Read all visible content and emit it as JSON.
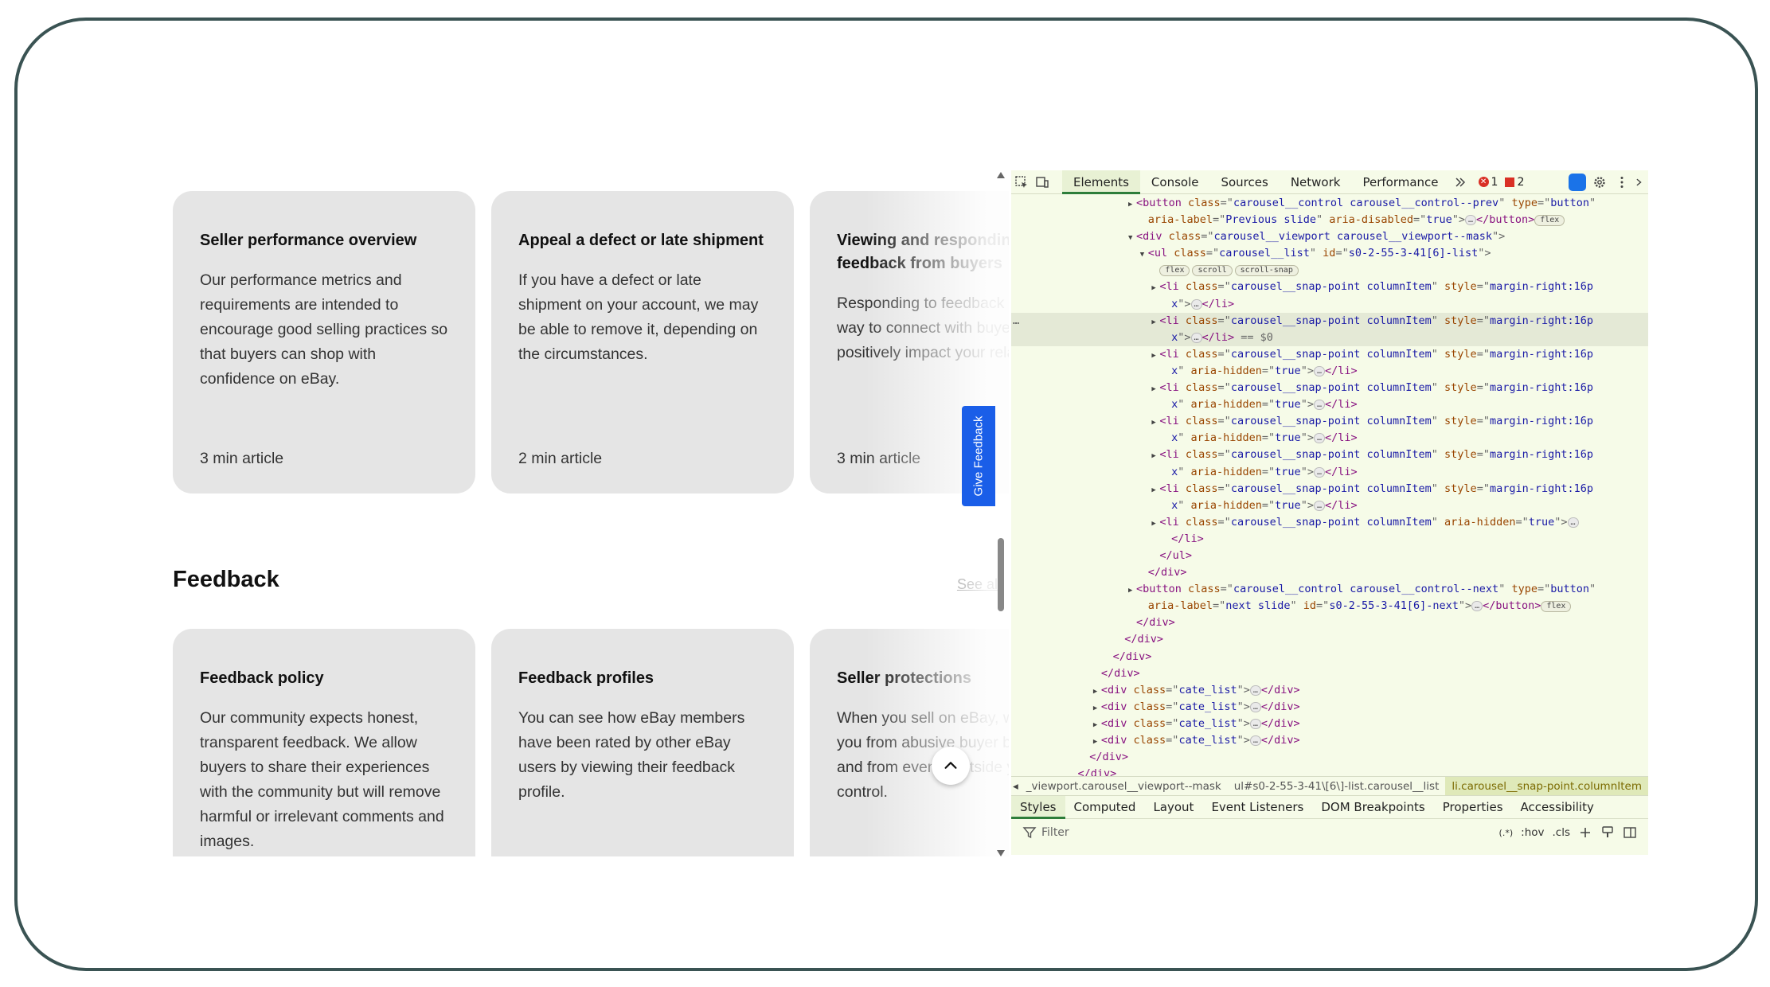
{
  "ebay": {
    "row1": [
      {
        "title": "Seller performance overview",
        "body": "Our performance metrics and requirements are intended to encourage good selling practices so that buyers can shop with confidence on eBay.",
        "meta": "3 min article"
      },
      {
        "title": "Appeal a defect or late shipment",
        "body": "If you have a defect or late shipment on your account, we may be able to remove it, depending on the circumstances.",
        "meta": "2 min article"
      },
      {
        "title": "Viewing and responding to feedback from buyers",
        "body": "Responding to feedback is a great way to connect with buyers and can positively impact your relationships.",
        "meta": "3 min article"
      }
    ],
    "section_title": "Feedback",
    "see_all": "See all",
    "row2": [
      {
        "title": "Feedback policy",
        "body": "Our community expects honest, transparent feedback. We allow buyers to share their experiences with the community but will remove harmful or irrelevant comments and images.",
        "meta": ""
      },
      {
        "title": "Feedback profiles",
        "body": "You can see how eBay members have been rated by other eBay users by viewing their feedback profile.",
        "meta": ""
      },
      {
        "title": "Seller protections",
        "body": "When you sell on eBay, we protect you from abusive buyer behavior and from events outside your control.",
        "meta": ""
      }
    ],
    "give_feedback": "Give Feedback"
  },
  "devtools": {
    "tabs": [
      "Elements",
      "Console",
      "Sources",
      "Network",
      "Performance"
    ],
    "error_count": "1",
    "warning_count": "2",
    "dom_lines": [
      {
        "indent": 10,
        "arrow": "▶",
        "parts": [
          [
            "t",
            "<button "
          ],
          [
            "a",
            "class"
          ],
          [
            "e",
            "=\""
          ],
          [
            "v",
            "carousel__control carousel__control--prev"
          ],
          [
            "e",
            "\" "
          ],
          [
            "a",
            "type"
          ],
          [
            "e",
            "=\""
          ],
          [
            "v",
            "button"
          ],
          [
            "e",
            "\""
          ]
        ]
      },
      {
        "indent": 11,
        "parts": [
          [
            "a",
            "aria-label"
          ],
          [
            "e",
            "=\""
          ],
          [
            "v",
            "Previous slide"
          ],
          [
            "e",
            "\" "
          ],
          [
            "a",
            "aria-disabled"
          ],
          [
            "e",
            "=\""
          ],
          [
            "v",
            "true"
          ],
          [
            "e",
            "\">"
          ],
          [
            "x",
            "…"
          ],
          [
            "t",
            "</button>"
          ],
          [
            "b",
            "flex"
          ]
        ]
      },
      {
        "indent": 10,
        "arrow": "▼",
        "parts": [
          [
            "t",
            "<div "
          ],
          [
            "a",
            "class"
          ],
          [
            "e",
            "=\""
          ],
          [
            "v",
            "carousel__viewport carousel__viewport--mask"
          ],
          [
            "e",
            "\">"
          ]
        ]
      },
      {
        "indent": 11,
        "arrow": "▼",
        "parts": [
          [
            "t",
            "<ul "
          ],
          [
            "a",
            "class"
          ],
          [
            "e",
            "=\""
          ],
          [
            "v",
            "carousel__list"
          ],
          [
            "e",
            "\" "
          ],
          [
            "a",
            "id"
          ],
          [
            "e",
            "=\""
          ],
          [
            "v",
            "s0-2-55-3-41[6]-list"
          ],
          [
            "e",
            "\">"
          ]
        ]
      },
      {
        "indent": 12,
        "parts": [
          [
            "b",
            "flex"
          ],
          [
            "b",
            "scroll"
          ],
          [
            "b",
            "scroll-snap"
          ]
        ]
      },
      {
        "indent": 12,
        "arrow": "▶",
        "parts": [
          [
            "t",
            "<li "
          ],
          [
            "a",
            "class"
          ],
          [
            "e",
            "=\""
          ],
          [
            "v",
            "carousel__snap-point columnItem"
          ],
          [
            "e",
            "\" "
          ],
          [
            "a",
            "style"
          ],
          [
            "e",
            "=\""
          ],
          [
            "v",
            "margin-right:16p"
          ]
        ]
      },
      {
        "indent": 13,
        "parts": [
          [
            "v",
            "x"
          ],
          [
            "e",
            "\">"
          ],
          [
            "x",
            "…"
          ],
          [
            "t",
            "</li>"
          ]
        ]
      },
      {
        "indent": 12,
        "arrow": "▶",
        "selected": true,
        "parts": [
          [
            "t",
            "<li "
          ],
          [
            "a",
            "class"
          ],
          [
            "e",
            "=\""
          ],
          [
            "v",
            "carousel__snap-point columnItem"
          ],
          [
            "e",
            "\" "
          ],
          [
            "a",
            "style"
          ],
          [
            "e",
            "=\""
          ],
          [
            "v",
            "margin-right:16p"
          ]
        ]
      },
      {
        "indent": 13,
        "selected": true,
        "parts": [
          [
            "v",
            "x"
          ],
          [
            "e",
            "\">"
          ],
          [
            "x",
            "…"
          ],
          [
            "t",
            "</li>"
          ],
          [
            "e",
            " == $0"
          ]
        ]
      },
      {
        "indent": 12,
        "arrow": "▶",
        "parts": [
          [
            "t",
            "<li "
          ],
          [
            "a",
            "class"
          ],
          [
            "e",
            "=\""
          ],
          [
            "v",
            "carousel__snap-point columnItem"
          ],
          [
            "e",
            "\" "
          ],
          [
            "a",
            "style"
          ],
          [
            "e",
            "=\""
          ],
          [
            "v",
            "margin-right:16p"
          ]
        ]
      },
      {
        "indent": 13,
        "parts": [
          [
            "v",
            "x"
          ],
          [
            "e",
            "\" "
          ],
          [
            "a",
            "aria-hidden"
          ],
          [
            "e",
            "=\""
          ],
          [
            "v",
            "true"
          ],
          [
            "e",
            "\">"
          ],
          [
            "x",
            "…"
          ],
          [
            "t",
            "</li>"
          ]
        ]
      },
      {
        "indent": 12,
        "arrow": "▶",
        "parts": [
          [
            "t",
            "<li "
          ],
          [
            "a",
            "class"
          ],
          [
            "e",
            "=\""
          ],
          [
            "v",
            "carousel__snap-point columnItem"
          ],
          [
            "e",
            "\" "
          ],
          [
            "a",
            "style"
          ],
          [
            "e",
            "=\""
          ],
          [
            "v",
            "margin-right:16p"
          ]
        ]
      },
      {
        "indent": 13,
        "parts": [
          [
            "v",
            "x"
          ],
          [
            "e",
            "\" "
          ],
          [
            "a",
            "aria-hidden"
          ],
          [
            "e",
            "=\""
          ],
          [
            "v",
            "true"
          ],
          [
            "e",
            "\">"
          ],
          [
            "x",
            "…"
          ],
          [
            "t",
            "</li>"
          ]
        ]
      },
      {
        "indent": 12,
        "arrow": "▶",
        "parts": [
          [
            "t",
            "<li "
          ],
          [
            "a",
            "class"
          ],
          [
            "e",
            "=\""
          ],
          [
            "v",
            "carousel__snap-point columnItem"
          ],
          [
            "e",
            "\" "
          ],
          [
            "a",
            "style"
          ],
          [
            "e",
            "=\""
          ],
          [
            "v",
            "margin-right:16p"
          ]
        ]
      },
      {
        "indent": 13,
        "parts": [
          [
            "v",
            "x"
          ],
          [
            "e",
            "\" "
          ],
          [
            "a",
            "aria-hidden"
          ],
          [
            "e",
            "=\""
          ],
          [
            "v",
            "true"
          ],
          [
            "e",
            "\">"
          ],
          [
            "x",
            "…"
          ],
          [
            "t",
            "</li>"
          ]
        ]
      },
      {
        "indent": 12,
        "arrow": "▶",
        "parts": [
          [
            "t",
            "<li "
          ],
          [
            "a",
            "class"
          ],
          [
            "e",
            "=\""
          ],
          [
            "v",
            "carousel__snap-point columnItem"
          ],
          [
            "e",
            "\" "
          ],
          [
            "a",
            "style"
          ],
          [
            "e",
            "=\""
          ],
          [
            "v",
            "margin-right:16p"
          ]
        ]
      },
      {
        "indent": 13,
        "parts": [
          [
            "v",
            "x"
          ],
          [
            "e",
            "\" "
          ],
          [
            "a",
            "aria-hidden"
          ],
          [
            "e",
            "=\""
          ],
          [
            "v",
            "true"
          ],
          [
            "e",
            "\">"
          ],
          [
            "x",
            "…"
          ],
          [
            "t",
            "</li>"
          ]
        ]
      },
      {
        "indent": 12,
        "arrow": "▶",
        "parts": [
          [
            "t",
            "<li "
          ],
          [
            "a",
            "class"
          ],
          [
            "e",
            "=\""
          ],
          [
            "v",
            "carousel__snap-point columnItem"
          ],
          [
            "e",
            "\" "
          ],
          [
            "a",
            "style"
          ],
          [
            "e",
            "=\""
          ],
          [
            "v",
            "margin-right:16p"
          ]
        ]
      },
      {
        "indent": 13,
        "parts": [
          [
            "v",
            "x"
          ],
          [
            "e",
            "\" "
          ],
          [
            "a",
            "aria-hidden"
          ],
          [
            "e",
            "=\""
          ],
          [
            "v",
            "true"
          ],
          [
            "e",
            "\">"
          ],
          [
            "x",
            "…"
          ],
          [
            "t",
            "</li>"
          ]
        ]
      },
      {
        "indent": 12,
        "arrow": "▶",
        "parts": [
          [
            "t",
            "<li "
          ],
          [
            "a",
            "class"
          ],
          [
            "e",
            "=\""
          ],
          [
            "v",
            "carousel__snap-point columnItem"
          ],
          [
            "e",
            "\" "
          ],
          [
            "a",
            "aria-hidden"
          ],
          [
            "e",
            "=\""
          ],
          [
            "v",
            "true"
          ],
          [
            "e",
            "\">"
          ],
          [
            "x",
            "…"
          ]
        ]
      },
      {
        "indent": 13,
        "parts": [
          [
            "t",
            "</li>"
          ]
        ]
      },
      {
        "indent": 12,
        "parts": [
          [
            "t",
            "</ul>"
          ]
        ]
      },
      {
        "indent": 11,
        "parts": [
          [
            "t",
            "</div>"
          ]
        ]
      },
      {
        "indent": 10,
        "arrow": "▶",
        "parts": [
          [
            "t",
            "<button "
          ],
          [
            "a",
            "class"
          ],
          [
            "e",
            "=\""
          ],
          [
            "v",
            "carousel__control carousel__control--next"
          ],
          [
            "e",
            "\" "
          ],
          [
            "a",
            "type"
          ],
          [
            "e",
            "=\""
          ],
          [
            "v",
            "button"
          ],
          [
            "e",
            "\""
          ]
        ]
      },
      {
        "indent": 11,
        "parts": [
          [
            "a",
            "aria-label"
          ],
          [
            "e",
            "=\""
          ],
          [
            "v",
            "next slide"
          ],
          [
            "e",
            "\" "
          ],
          [
            "a",
            "id"
          ],
          [
            "e",
            "=\""
          ],
          [
            "v",
            "s0-2-55-3-41[6]-next"
          ],
          [
            "e",
            "\">"
          ],
          [
            "x",
            "…"
          ],
          [
            "t",
            "</button>"
          ],
          [
            "b",
            "flex"
          ]
        ]
      },
      {
        "indent": 10,
        "parts": [
          [
            "t",
            "</div>"
          ]
        ]
      },
      {
        "indent": 9,
        "parts": [
          [
            "t",
            "</div>"
          ]
        ]
      },
      {
        "indent": 8,
        "parts": [
          [
            "t",
            "</div>"
          ]
        ]
      },
      {
        "indent": 7,
        "parts": [
          [
            "t",
            "</div>"
          ]
        ]
      },
      {
        "indent": 7,
        "arrow": "▶",
        "parts": [
          [
            "t",
            "<div "
          ],
          [
            "a",
            "class"
          ],
          [
            "e",
            "=\""
          ],
          [
            "v",
            "cate_list"
          ],
          [
            "e",
            "\">"
          ],
          [
            "x",
            "…"
          ],
          [
            "t",
            "</div>"
          ]
        ]
      },
      {
        "indent": 7,
        "arrow": "▶",
        "parts": [
          [
            "t",
            "<div "
          ],
          [
            "a",
            "class"
          ],
          [
            "e",
            "=\""
          ],
          [
            "v",
            "cate_list"
          ],
          [
            "e",
            "\">"
          ],
          [
            "x",
            "…"
          ],
          [
            "t",
            "</div>"
          ]
        ]
      },
      {
        "indent": 7,
        "arrow": "▶",
        "parts": [
          [
            "t",
            "<div "
          ],
          [
            "a",
            "class"
          ],
          [
            "e",
            "=\""
          ],
          [
            "v",
            "cate_list"
          ],
          [
            "e",
            "\">"
          ],
          [
            "x",
            "…"
          ],
          [
            "t",
            "</div>"
          ]
        ]
      },
      {
        "indent": 7,
        "arrow": "▶",
        "parts": [
          [
            "t",
            "<div "
          ],
          [
            "a",
            "class"
          ],
          [
            "e",
            "=\""
          ],
          [
            "v",
            "cate_list"
          ],
          [
            "e",
            "\">"
          ],
          [
            "x",
            "…"
          ],
          [
            "t",
            "</div>"
          ]
        ]
      },
      {
        "indent": 6,
        "parts": [
          [
            "t",
            "</div>"
          ]
        ]
      },
      {
        "indent": 5,
        "parts": [
          [
            "t",
            "</div>"
          ]
        ]
      }
    ],
    "breadcrumbs": [
      "_viewport.carousel__viewport--mask",
      "ul#s0-2-55-3-41\\[6\\]-list.carousel__list",
      "li.carousel__snap-point.columnItem"
    ],
    "subtabs": [
      "Styles",
      "Computed",
      "Layout",
      "Event Listeners",
      "DOM Breakpoints",
      "Properties",
      "Accessibility"
    ],
    "filter_placeholder": "Filter",
    "filter_tools": [
      ":hov",
      ".cls"
    ],
    "regex_label": "(.*)"
  }
}
